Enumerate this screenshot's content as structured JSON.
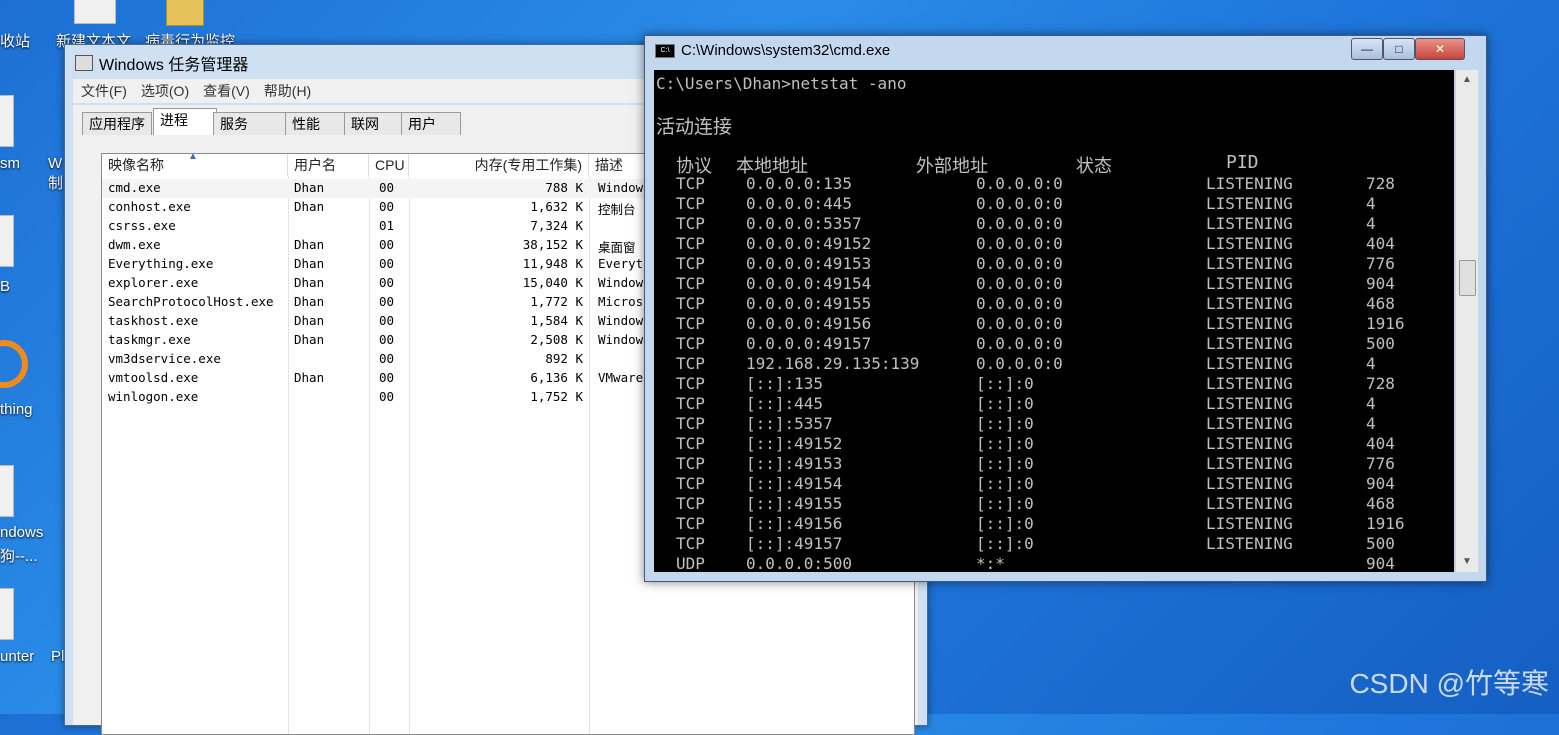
{
  "desktop": {
    "icons": [
      "收站",
      "新建文本文",
      "病毒行为监控",
      "sm",
      "W制",
      "B",
      "thing",
      "ndows",
      "狗--...",
      "unter",
      "Pl"
    ]
  },
  "taskmgr": {
    "title": "Windows 任务管理器",
    "menu": [
      "文件(F)",
      "选项(O)",
      "查看(V)",
      "帮助(H)"
    ],
    "tabs": [
      "应用程序",
      "进程",
      "服务",
      "性能",
      "联网",
      "用户"
    ],
    "active_tab": "进程",
    "columns": [
      "映像名称",
      "用户名",
      "CPU",
      "内存(专用工作集)",
      "描述"
    ],
    "rows": [
      {
        "name": "cmd.exe",
        "user": "Dhan",
        "cpu": "00",
        "mem": "788 K",
        "desc": "Window"
      },
      {
        "name": "conhost.exe",
        "user": "Dhan",
        "cpu": "00",
        "mem": "1,632 K",
        "desc": "控制台"
      },
      {
        "name": "csrss.exe",
        "user": "",
        "cpu": "01",
        "mem": "7,324 K",
        "desc": ""
      },
      {
        "name": "dwm.exe",
        "user": "Dhan",
        "cpu": "00",
        "mem": "38,152 K",
        "desc": "桌面窗"
      },
      {
        "name": "Everything.exe",
        "user": "Dhan",
        "cpu": "00",
        "mem": "11,948 K",
        "desc": "Everyt"
      },
      {
        "name": "explorer.exe",
        "user": "Dhan",
        "cpu": "00",
        "mem": "15,040 K",
        "desc": "Window"
      },
      {
        "name": "SearchProtocolHost.exe",
        "user": "Dhan",
        "cpu": "00",
        "mem": "1,772 K",
        "desc": "Micros"
      },
      {
        "name": "taskhost.exe",
        "user": "Dhan",
        "cpu": "00",
        "mem": "1,584 K",
        "desc": "Window"
      },
      {
        "name": "taskmgr.exe",
        "user": "Dhan",
        "cpu": "00",
        "mem": "2,508 K",
        "desc": "Window"
      },
      {
        "name": "vm3dservice.exe",
        "user": "",
        "cpu": "00",
        "mem": "892 K",
        "desc": ""
      },
      {
        "name": "vmtoolsd.exe",
        "user": "Dhan",
        "cpu": "00",
        "mem": "6,136 K",
        "desc": "VMware"
      },
      {
        "name": "winlogon.exe",
        "user": "",
        "cpu": "00",
        "mem": "1,752 K",
        "desc": ""
      }
    ]
  },
  "cmd": {
    "title": "C:\\Windows\\system32\\cmd.exe",
    "icon_label": "C:\\",
    "buttons": {
      "minimize": "—",
      "maximize": "□",
      "close": "✕"
    },
    "prompt": "C:\\Users\\Dhan>netstat -ano",
    "heading": "活动连接",
    "columns": [
      "协议",
      "本地地址",
      "外部地址",
      "状态",
      "PID"
    ],
    "connections": [
      {
        "proto": "TCP",
        "local": "0.0.0.0:135",
        "foreign": "0.0.0.0:0",
        "state": "LISTENING",
        "pid": "728"
      },
      {
        "proto": "TCP",
        "local": "0.0.0.0:445",
        "foreign": "0.0.0.0:0",
        "state": "LISTENING",
        "pid": "4"
      },
      {
        "proto": "TCP",
        "local": "0.0.0.0:5357",
        "foreign": "0.0.0.0:0",
        "state": "LISTENING",
        "pid": "4"
      },
      {
        "proto": "TCP",
        "local": "0.0.0.0:49152",
        "foreign": "0.0.0.0:0",
        "state": "LISTENING",
        "pid": "404"
      },
      {
        "proto": "TCP",
        "local": "0.0.0.0:49153",
        "foreign": "0.0.0.0:0",
        "state": "LISTENING",
        "pid": "776"
      },
      {
        "proto": "TCP",
        "local": "0.0.0.0:49154",
        "foreign": "0.0.0.0:0",
        "state": "LISTENING",
        "pid": "904"
      },
      {
        "proto": "TCP",
        "local": "0.0.0.0:49155",
        "foreign": "0.0.0.0:0",
        "state": "LISTENING",
        "pid": "468"
      },
      {
        "proto": "TCP",
        "local": "0.0.0.0:49156",
        "foreign": "0.0.0.0:0",
        "state": "LISTENING",
        "pid": "1916"
      },
      {
        "proto": "TCP",
        "local": "0.0.0.0:49157",
        "foreign": "0.0.0.0:0",
        "state": "LISTENING",
        "pid": "500"
      },
      {
        "proto": "TCP",
        "local": "192.168.29.135:139",
        "foreign": "0.0.0.0:0",
        "state": "LISTENING",
        "pid": "4"
      },
      {
        "proto": "TCP",
        "local": "[::]:135",
        "foreign": "[::]:0",
        "state": "LISTENING",
        "pid": "728"
      },
      {
        "proto": "TCP",
        "local": "[::]:445",
        "foreign": "[::]:0",
        "state": "LISTENING",
        "pid": "4"
      },
      {
        "proto": "TCP",
        "local": "[::]:5357",
        "foreign": "[::]:0",
        "state": "LISTENING",
        "pid": "4"
      },
      {
        "proto": "TCP",
        "local": "[::]:49152",
        "foreign": "[::]:0",
        "state": "LISTENING",
        "pid": "404"
      },
      {
        "proto": "TCP",
        "local": "[::]:49153",
        "foreign": "[::]:0",
        "state": "LISTENING",
        "pid": "776"
      },
      {
        "proto": "TCP",
        "local": "[::]:49154",
        "foreign": "[::]:0",
        "state": "LISTENING",
        "pid": "904"
      },
      {
        "proto": "TCP",
        "local": "[::]:49155",
        "foreign": "[::]:0",
        "state": "LISTENING",
        "pid": "468"
      },
      {
        "proto": "TCP",
        "local": "[::]:49156",
        "foreign": "[::]:0",
        "state": "LISTENING",
        "pid": "1916"
      },
      {
        "proto": "TCP",
        "local": "[::]:49157",
        "foreign": "[::]:0",
        "state": "LISTENING",
        "pid": "500"
      },
      {
        "proto": "UDP",
        "local": "0.0.0.0:500",
        "foreign": "*:*",
        "state": "",
        "pid": "904"
      }
    ]
  },
  "watermark": "CSDN @竹等寒",
  "colors": {
    "desktop": "#1f76dc",
    "console_bg": "#000000",
    "console_fg": "#c0c0c0",
    "close_button": "#c8453b"
  }
}
